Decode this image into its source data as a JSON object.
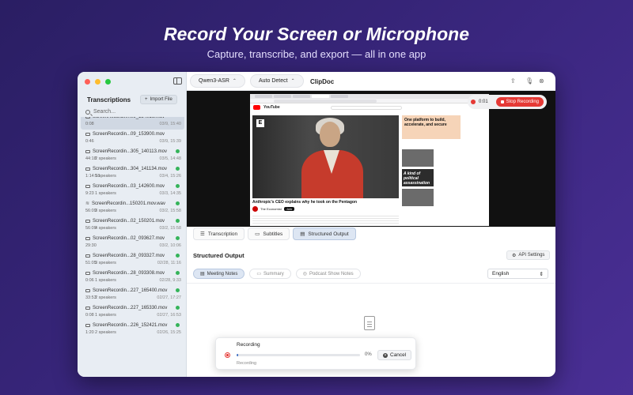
{
  "hero": {
    "title": "Record Your Screen or Microphone",
    "subtitle": "Capture, transcribe, and export — all in one app"
  },
  "colors": {
    "background": "#3b2780",
    "accent": "#4a78c8",
    "record": "#e53935",
    "done": "#35b45a"
  },
  "sidebar": {
    "heading": "Transcriptions",
    "import_label": "Import File",
    "search_placeholder": "Search...",
    "items": [
      {
        "name": "ScreenRecordin...09_154016.mov",
        "duration": "0:08",
        "speakers": "",
        "date": "03/9, 15:40",
        "kind": "video",
        "selected": true,
        "done": false
      },
      {
        "name": "ScreenRecordin...09_153900.mov",
        "duration": "0:46",
        "speakers": "",
        "date": "03/9, 15:39",
        "kind": "video",
        "done": false
      },
      {
        "name": "ScreenRecordin...305_140113.mov",
        "duration": "44:18",
        "speakers": "2 speakers",
        "date": "03/5, 14:48",
        "kind": "video",
        "done": true
      },
      {
        "name": "ScreenRecordin...304_141134.mov",
        "duration": "1:14:18",
        "speakers": "5 speakers",
        "date": "03/4, 15:26",
        "kind": "video",
        "done": true
      },
      {
        "name": "ScreenRecordin...03_142600.mov",
        "duration": "9:23",
        "speakers": "1 speakers",
        "date": "03/3, 14:35",
        "kind": "video",
        "done": true
      },
      {
        "name": "ScreenRecordin...150201.mov.wav",
        "duration": "56:09",
        "speakers": "3 speakers",
        "date": "03/2, 15:58",
        "kind": "audio",
        "done": true
      },
      {
        "name": "ScreenRecordin...02_150201.mov",
        "duration": "56:09",
        "speakers": "4 speakers",
        "date": "03/2, 15:58",
        "kind": "video",
        "done": true
      },
      {
        "name": "ScreenRecordin...02_093627.mov",
        "duration": "29:30",
        "speakers": "",
        "date": "03/2, 10:06",
        "kind": "video",
        "done": true
      },
      {
        "name": "ScreenRecordin...28_093327.mov",
        "duration": "51:05",
        "speakers": "3 speakers",
        "date": "02/28, 11:16",
        "kind": "video",
        "done": true
      },
      {
        "name": "ScreenRecordin...28_093308.mov",
        "duration": "0:06",
        "speakers": "1 speakers",
        "date": "02/28, 9:33",
        "kind": "video",
        "done": true
      },
      {
        "name": "ScreenRecordin...227_165400.mov",
        "duration": "33:53",
        "speakers": "2 speakers",
        "date": "02/27, 17:27",
        "kind": "video",
        "done": true
      },
      {
        "name": "ScreenRecordin...227_165330.mov",
        "duration": "0:08",
        "speakers": "1 speakers",
        "date": "02/27, 16:53",
        "kind": "video",
        "done": true
      },
      {
        "name": "ScreenRecordin...226_152421.mov",
        "duration": "1:20",
        "speakers": "2 speakers",
        "date": "02/26, 15:25",
        "kind": "video",
        "done": true
      }
    ]
  },
  "header": {
    "model": "Qwen3-ASR",
    "language_detect": "Auto Detect",
    "app_name": "ClipDoc"
  },
  "preview": {
    "video_title": "Anthropic's CEO explains why he took on the Pentagon",
    "channel": "The Economist",
    "subscribe": "Join",
    "ad_title": "One platform to build, accelerate, and secure",
    "thumb1_title": "A kind of political assassination",
    "recording_time": "0:01",
    "stop_label": "Stop Recording"
  },
  "tabs": {
    "items": [
      {
        "label": "Transcription",
        "active": false
      },
      {
        "label": "Subtitles",
        "active": false
      },
      {
        "label": "Structured Output",
        "active": true
      }
    ]
  },
  "structured": {
    "title": "Structured Output",
    "api_settings": "API Settings",
    "subtabs": [
      {
        "label": "Meeting Notes",
        "active": true
      },
      {
        "label": "Summary",
        "active": false
      },
      {
        "label": "Podcast Show Notes",
        "active": false
      }
    ],
    "language": "English"
  },
  "toast": {
    "label": "Recording",
    "progress_percent": 0,
    "percent_text": "0%",
    "status": "Recording",
    "cancel_label": "Cancel"
  }
}
